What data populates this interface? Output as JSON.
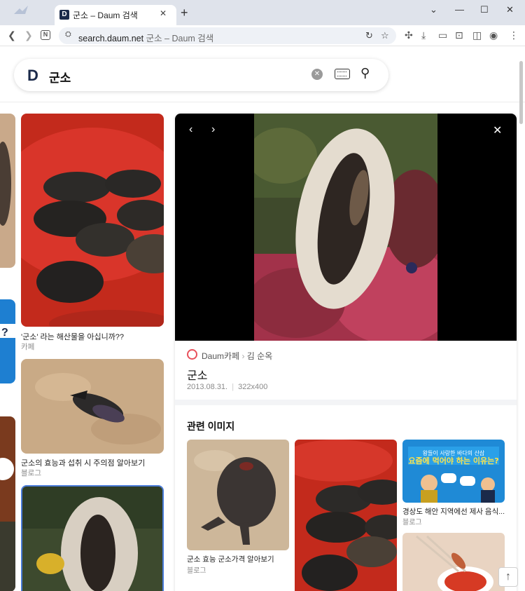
{
  "browser": {
    "tab_title": "군소 – Daum 검색",
    "tab_favicon": "D",
    "new_tab": "+",
    "url_host": "search.daum.net",
    "url_rest": " 군소 – Daum 검색"
  },
  "search": {
    "logo": "D",
    "query": "군소"
  },
  "results": [
    {
      "caption": "'군소' 라는 해산물을 아십니까??",
      "source": "카페"
    },
    {
      "caption": "군소의 효능과 섭취 시 주의점 알아보기",
      "source": "블로그"
    }
  ],
  "viewer": {
    "source_site": "Daum카페",
    "source_sep": "›",
    "source_author": "김 순옥",
    "title": "군소",
    "date": "2013.08.31.",
    "size": "322x400",
    "related_heading": "관련 이미지",
    "related": [
      {
        "caption": "군소 효능 군소가격 알아보기",
        "source": "블로그"
      },
      {
        "caption": "경상도 해안 지역에선 제사 음식...",
        "source": "블로그"
      }
    ],
    "banner_top": "왕들이 사랑한 바다의 산삼",
    "banner_main": "요즘에 먹어야 하는 이유는?"
  },
  "colors": {
    "brand": "#1b2a4a",
    "cafe_icon": "#e8505b",
    "selected_border": "#4a7bd8"
  }
}
